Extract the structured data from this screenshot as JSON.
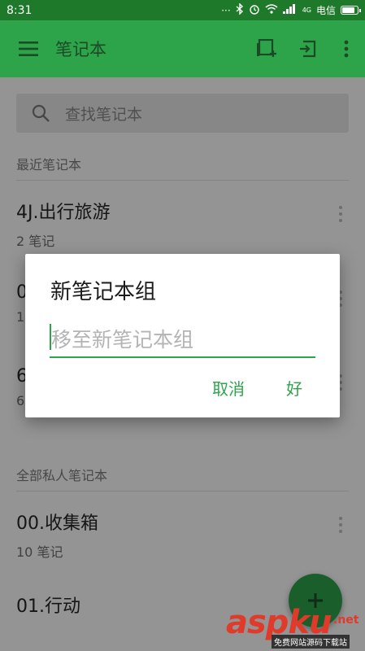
{
  "status_bar": {
    "time": "8:31",
    "carrier": "电信",
    "network": "4G",
    "battery_level": 0.9
  },
  "app_bar": {
    "title": "笔记本",
    "menu_icon": "hamburger-menu-icon",
    "actions": [
      "new-notebook-stack-icon",
      "move-to-stack-icon",
      "overflow-menu-icon"
    ]
  },
  "search": {
    "placeholder": "查找笔记本"
  },
  "sections": {
    "recent": "最近笔记本",
    "all_private": "全部私人笔记本"
  },
  "recent_notebooks": [
    {
      "name": "4J.出行旅游",
      "count": "2 笔记"
    },
    {
      "name": "0",
      "count": "1"
    },
    {
      "name": "6",
      "count": "6"
    }
  ],
  "all_notebooks": [
    {
      "name": "00.收集箱",
      "count": "10 笔记"
    },
    {
      "name": "01.行动",
      "count": ""
    }
  ],
  "dialog": {
    "title": "新笔记本组",
    "input_placeholder": "移至新笔记本组",
    "cancel_label": "取消",
    "ok_label": "好"
  },
  "watermark": {
    "brand": "aspku",
    "suffix": ".net",
    "subtitle": "免费网站源码下载站"
  },
  "colors": {
    "primary": "#2da44a",
    "status_bar": "#1e7a2a",
    "watermark": "#e03a2b"
  }
}
